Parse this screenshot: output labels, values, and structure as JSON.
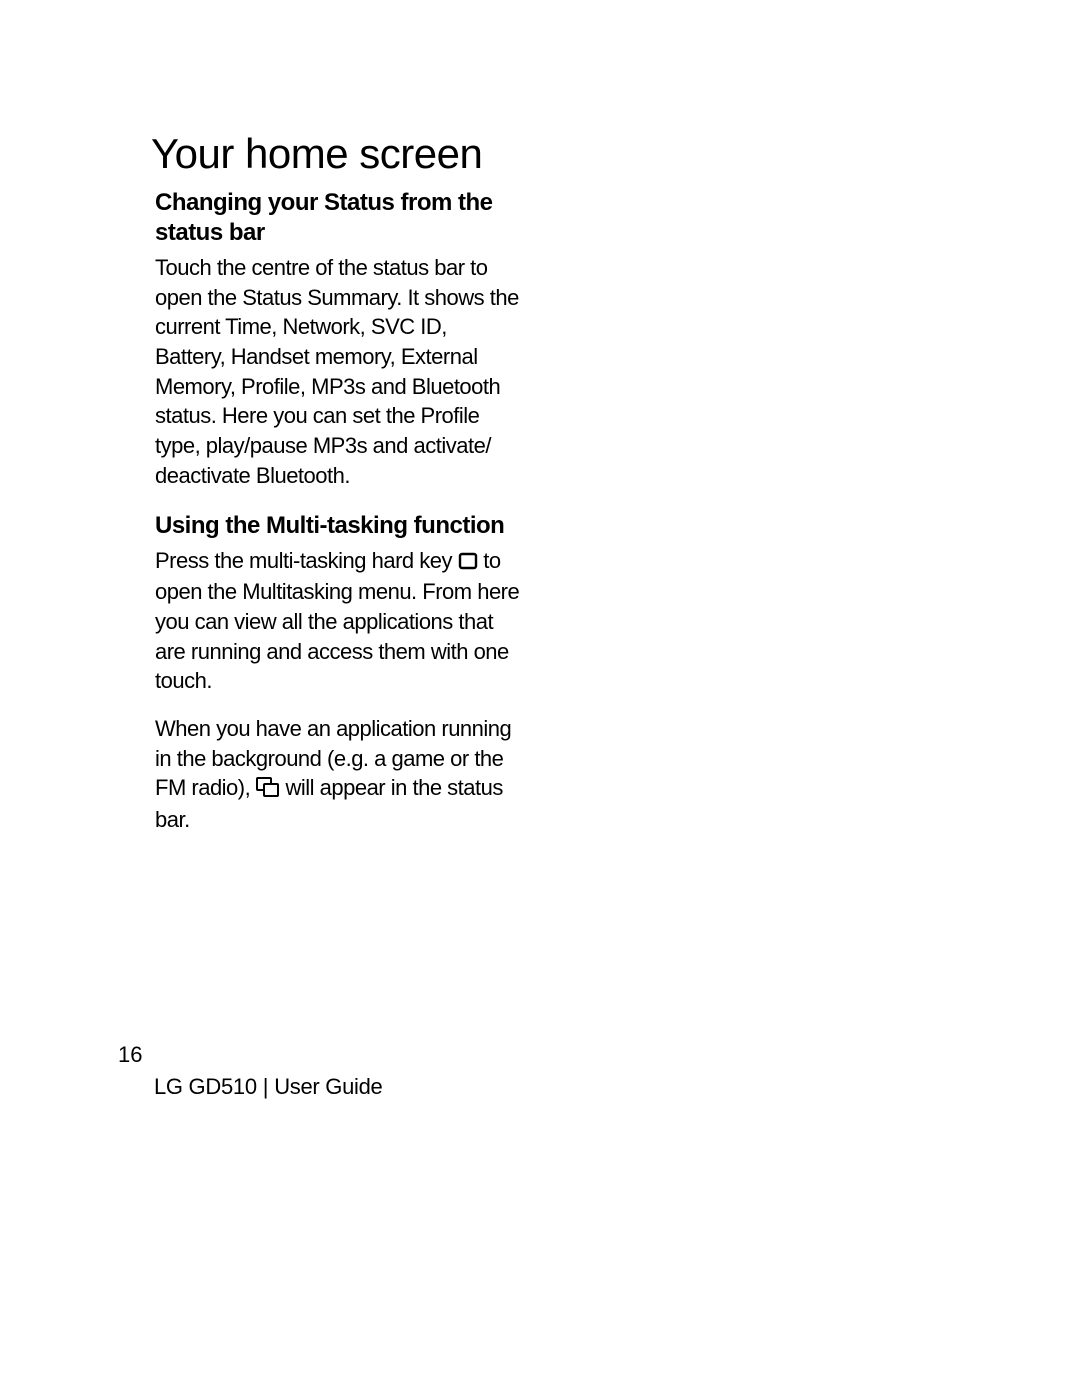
{
  "page_title": "Your home screen",
  "sections": [
    {
      "heading": "Changing your Status from the status bar",
      "paragraphs": [
        "Touch the centre of the status bar to open the Status Summary. It shows the current Time, Network, SVC ID, Battery, Handset memory, External Memory, Profile, MP3s and Bluetooth status. Here you can set the Profile type, play/pause MP3s and activate/ deactivate Bluetooth."
      ]
    },
    {
      "heading": "Using the Multi-tasking function",
      "para2_pre": "Press the multi-tasking hard key ",
      "para2_post": " to open the Multitasking menu. From here you can view all the applications that are running and access them with one touch.",
      "para3_pre": "When you  have an application running in the background (e.g. a game or the FM radio), ",
      "para3_post": " will appear in the status bar."
    }
  ],
  "footer": {
    "page_number": "16",
    "model": "LG GD510",
    "doc_type": "User Guide"
  }
}
